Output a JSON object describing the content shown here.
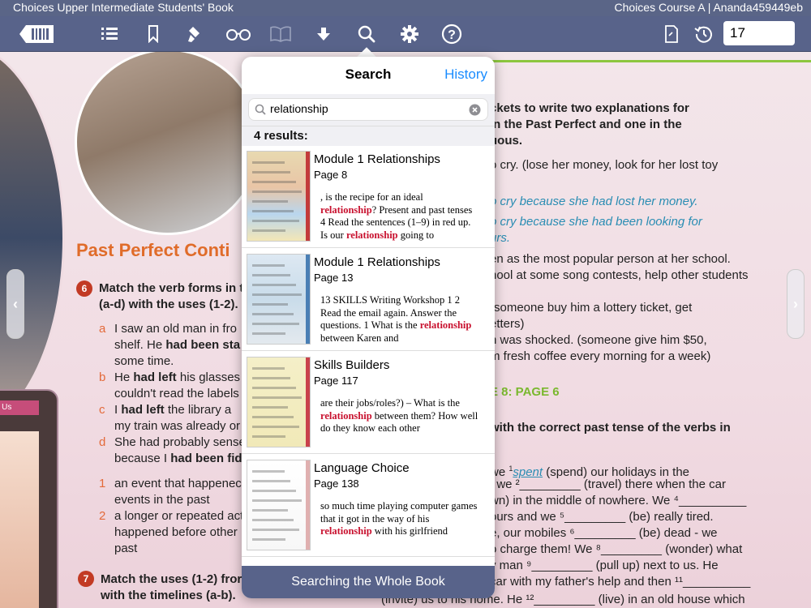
{
  "statusbar": {
    "book_title": "Choices Upper Intermediate Students' Book",
    "course_user": "Choices Course A | Ananda459449eb"
  },
  "toolbar": {
    "icons": [
      "library-icon",
      "toc-icon",
      "bookmark-icon",
      "highlighter-icon",
      "glasses-icon",
      "book-open-icon",
      "download-icon",
      "search-icon",
      "settings-icon",
      "help-icon",
      "notes-icon",
      "history-icon"
    ],
    "page_number": "17"
  },
  "search_popover": {
    "title": "Search",
    "history_label": "History",
    "query": "relationship",
    "results_count": "4 results:",
    "results": [
      {
        "title": "Module 1 Relationships",
        "page": "Page 8",
        "snippet_before": ", is the recipe for an ideal ",
        "match": "relationship",
        "snippet_after": "? Present and past tenses 4 Read the sentences (1–9) in red up. Is our ",
        "match2": "relationship",
        "snippet_tail": " going to"
      },
      {
        "title": "Module 1 Relationships",
        "page": "Page 13",
        "snippet_before": "13 SKILLS Writing Workshop 1 2 Read the email again. Answer the questions. 1 What is the ",
        "match": "relationship",
        "snippet_after": " between Karen and",
        "match2": "",
        "snippet_tail": ""
      },
      {
        "title": "Skills Builders",
        "page": "Page 117",
        "snippet_before": "are their jobs/roles?) – What is the ",
        "match": "relationship",
        "snippet_after": " between them? How well do they know each other",
        "match2": "",
        "snippet_tail": ""
      },
      {
        "title": "Language Choice",
        "page": "Page 138",
        "snippet_before": "so much time playing computer games that it got in the way of his ",
        "match": "relationship",
        "snippet_after": " with his girlfriend",
        "match2": "",
        "snippet_tail": ""
      }
    ],
    "footer": "Searching the Whole Book"
  },
  "left_page": {
    "phone_badge": "act Us",
    "heading": "Past Perfect Conti",
    "ex6_number": "6",
    "ex6_line1": "Match the verb forms in t",
    "ex6_line2": "(a-d) with the uses (1-2).",
    "items": [
      {
        "mark": "a",
        "lines": [
          "I saw an old man in fro",
          "shelf. He |had been sta",
          "some time."
        ]
      },
      {
        "mark": "b",
        "lines": [
          "He |had left| his glasses",
          "couldn't read the labels"
        ]
      },
      {
        "mark": "c",
        "lines": [
          "I |had left| the library a",
          "my train was already or"
        ]
      },
      {
        "mark": "d",
        "lines": [
          "She had probably sense",
          "because I |had been fid"
        ]
      }
    ],
    "uses": [
      {
        "mark": "1",
        "lines": [
          "an event that happenec",
          "events in the past"
        ]
      },
      {
        "mark": "2",
        "lines": [
          "a longer or repeated act",
          "happened before other",
          "past"
        ]
      }
    ],
    "ex7_number": "7",
    "ex7_line1": "Match the uses (1-2) fror",
    "ex7_line2": "with the timelines (a-b)."
  },
  "right_page": {
    "intro1": "ckets to write two explanations for",
    "intro2": "in the Past Perfect and one in the",
    "intro3": "uous.",
    "ex1": "o cry. (lose her money, look for her lost toy",
    "ans1": "o cry because she had lost her money.",
    "ans2": "o cry because she had been looking for",
    "ans3": "urs.",
    "l1": "en as the most popular person at her school.",
    "l2": "hool at some song contests, help other students",
    "l3": "(someone buy him a lottery ticket, get",
    "l4": "etters)",
    "l5": "n was shocked. (someone give him $50,",
    "l6": "m fresh coffee every morning for a week)",
    "section": "E 8: PAGE 6",
    "ex_head": "with the correct past tense of the verbs in",
    "p1_pre": "we ",
    "p1_sup": "1",
    "p1_ans": "spent",
    "p1_post": " (spend) our holidays in the",
    "p2": ", we ²_________ (travel) there when the car",
    "p3": "wn) in the middle of nowhere. We ⁴__________",
    "p4": "ours and we ⁵_________ (be) really tired.",
    "p5": "e, our mobiles ⁶_________ (be) dead - we",
    "p6": "o charge them!  We ⁸_________ (wonder) what",
    "p7": "y man ⁹_________ (pull up) next to us. He",
    "p8": "car with my father's help and then ¹¹__________",
    "p9": "(invite) us to his home. He ¹²_________ (live) in an old house which"
  },
  "colors": {
    "toolbar": "#58638a",
    "accent_blue": "#1a8cff",
    "highlight_red": "#c8102e",
    "heading_orange": "#e06c2a",
    "answer_blue": "#2a8db3"
  }
}
